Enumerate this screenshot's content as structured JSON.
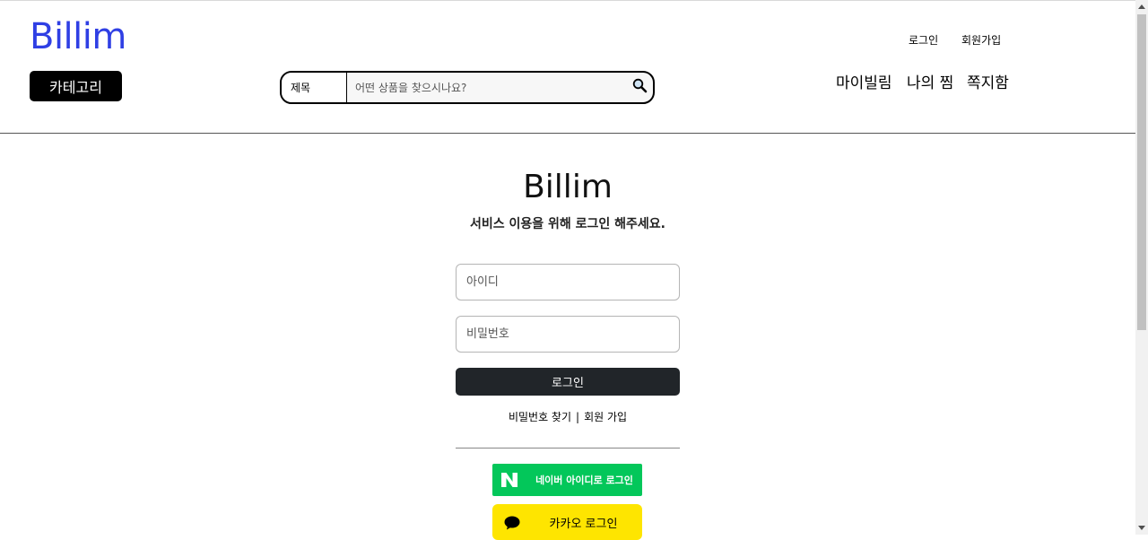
{
  "header": {
    "logo": "Billim",
    "category_button": "카테고리",
    "search": {
      "type_label": "제목",
      "placeholder": "어떤 상품을 찾으시나요?"
    },
    "top_links": {
      "login": "로그인",
      "signup": "회원가입"
    },
    "nav": {
      "my_billim": "마이빌림",
      "my_wishlist": "나의 찜",
      "messages": "쪽지함"
    }
  },
  "login": {
    "title": "Billim",
    "subtitle": "서비스 이용을 위해 로그인 해주세요.",
    "id_placeholder": "아이디",
    "password_placeholder": "비밀번호",
    "submit_label": "로그인",
    "find_password": "비밀번호 찾기",
    "separator": "|",
    "signup": "회원 가입",
    "naver_label": "네이버 아이디로 로그인",
    "kakao_label": "카카오 로그인"
  },
  "colors": {
    "logo": "#2f3fe4",
    "naver": "#03c75a",
    "kakao": "#fee500",
    "login_button": "#212529"
  },
  "icons": {
    "search": "magnifier-icon",
    "naver": "naver-n-icon",
    "kakao": "speech-bubble-icon"
  }
}
